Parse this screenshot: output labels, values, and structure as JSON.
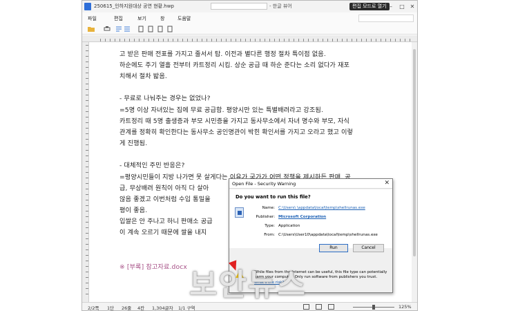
{
  "window": {
    "title": "250615_인하지원대상 공연 현황.hwp",
    "title_suffix": "- 한글 뷰어",
    "edit_mode_button": "편집 모드로 열기",
    "controls": {
      "minimize": "–",
      "maximize": "□",
      "close": "✕"
    }
  },
  "menu": [
    "파일",
    "편집",
    "보기",
    "창",
    "도움말"
  ],
  "document": {
    "lines": [
      "고 받은 판매 전표를 가지고 줄서서 탑. 이전과 별다른 행정 절차 특이점 없음.",
      "하순에도 주기 열흘 전부터 카트정리 시킴. 상순 공급 때 하순 준다는 소리 없다가 재포",
      "치해서 절차 밟음.",
      "",
      "- 무료로 나눠주는 경우는 없었나?",
      "=5명 이상 자녀있는 집에 무료 공급함. 평양시만 있는 특별배려라고 강조됨.",
      "카트정리 때 5명 출생증과 부모 시민증을 가지고 동사무소에서 자녀 명수와 부모, 자식",
      "관계를 정확히 확인한다는 동사무소 공인명관이 박힌 확인서를 가지고 오라고 했고 이렇",
      "게 진행됨.",
      "",
      "- 대체적인 주민 반응은?",
      "=평양시민들이 지방 나가면 못 살게다는 이유가 국가가 어떤 정책을 제시하든 판매, 공",
      "급, 무상배려 원칙이 아직 다 살아",
      "않음 좋겠고 이번처럼 수입 통밀을",
      "평이 좋음.",
      "입쌀은 안 주나고 하니 판매소 공급",
      "이 계속 오르기 때문에 쌀을 내지"
    ],
    "appendix": "※ [부록] 참고자료.docx"
  },
  "status": {
    "page": "2/2쪽",
    "section": "1단",
    "line": "26줄",
    "col": "4칸",
    "chars": "1,304글자",
    "area": "1/1 구역",
    "zoom": "125%"
  },
  "dialog": {
    "title": "Open File - Security Warning",
    "close": "✕",
    "question": "Do you want to run this file?",
    "fields": [
      {
        "label": "Name:",
        "value": "C:\\Users\\          \\appdata\\local\\temp\\shellrunas.exe"
      },
      {
        "label": "Publisher:",
        "value": "Microsoft Corporation"
      },
      {
        "label": "Type:",
        "value": "Application"
      },
      {
        "label": "From:",
        "value": "C:\\Users\\User10\\appdata\\local\\temp\\shellrunas.exe"
      }
    ],
    "run_button": "Run",
    "cancel_button": "Cancel",
    "warning_line1": "While files from the Internet can be useful, this file type can potentially",
    "warning_line2": "harm your computer. Only run software from publishers you trust.",
    "warning_link": "What's the risk?"
  },
  "watermark": "보안뉴스",
  "colors": {
    "appendix_pink": "#a64f86",
    "link_blue": "#1a5fb4",
    "edit_button_bg": "#2b2b2b"
  }
}
